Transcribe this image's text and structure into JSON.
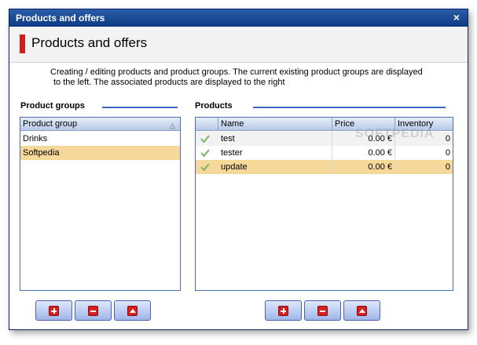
{
  "window": {
    "title": "Products and offers",
    "close_glyph": "×"
  },
  "header": {
    "title": "Products and offers"
  },
  "description": {
    "line1": "Creating / editing products and product groups. The current existing product groups are displayed",
    "line2": "to the left. The associated products are displayed to the right"
  },
  "groups": {
    "title": "Product groups",
    "column": "Product group",
    "sort_glyph": "△",
    "items": [
      {
        "label": "Drinks",
        "selected": false
      },
      {
        "label": "Softpedia",
        "selected": true
      }
    ]
  },
  "products": {
    "title": "Products",
    "columns": {
      "name": "Name",
      "price": "Price",
      "inventory": "Inventory"
    },
    "rows": [
      {
        "name": "test",
        "price": "0.00 €",
        "inventory": "0",
        "selected": false
      },
      {
        "name": "tester",
        "price": "0.00 €",
        "inventory": "0",
        "selected": false
      },
      {
        "name": "update",
        "price": "0.00 €",
        "inventory": "0",
        "selected": true
      }
    ]
  },
  "watermark": "SOFTPEDIA",
  "colors": {
    "titlebar": "#0d3a84",
    "accent_line": "#3a6ac2",
    "header_mark": "#cc1f1f",
    "selection": "#f6d89a"
  },
  "icons": [
    "close-icon",
    "sort-asc-icon",
    "check-icon",
    "add-icon",
    "remove-icon",
    "move-up-icon"
  ]
}
